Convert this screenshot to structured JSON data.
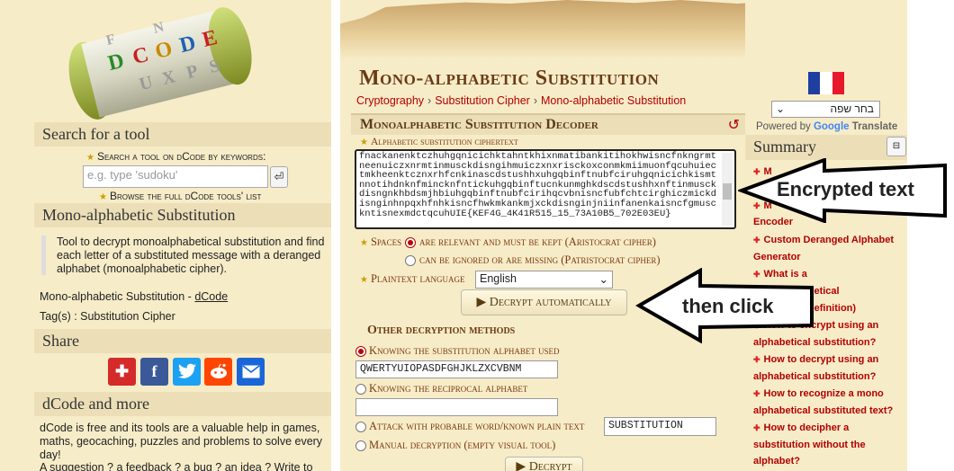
{
  "left": {
    "logo_text": "DCODE",
    "search_header": "Search for a tool",
    "search_label": "Search a tool on dCode by keywords:",
    "search_placeholder": "e.g. type 'sudoku'",
    "search_go_icon": "enter-icon",
    "browse_text": "Browse the full dCode tools' list",
    "tool_header": "Mono-alphabetic Substitution",
    "tool_desc": "Tool to decrypt monoalphabetical substitution and find each letter of a substituted message with a deranged alphabet (monoalphabetic cipher).",
    "credit_prefix": "Mono-alphabetic Substitution - ",
    "credit_link": "dCode",
    "tags": "Tag(s) : Substitution Cipher",
    "share_header": "Share",
    "share_buttons": [
      {
        "icon": "plus-icon",
        "color": "#d42a2a"
      },
      {
        "icon": "facebook-icon",
        "color": "#3b5998"
      },
      {
        "icon": "twitter-icon",
        "color": "#1da1f2"
      },
      {
        "icon": "reddit-icon",
        "color": "#ff4500"
      },
      {
        "icon": "email-icon",
        "color": "#1a66d8"
      }
    ],
    "more_header": "dCode and more",
    "more_text": "dCode is free and its tools are a valuable help in games, maths, geocaching, puzzles and problems to solve every day!",
    "more_text2": "A suggestion ? a feedback ? a bug ? an idea ? Write to"
  },
  "main": {
    "title": "Mono-alphabetic Substitution",
    "breadcrumb": [
      "Cryptography",
      "Substitution Cipher",
      "Mono-alphabetic Substitution"
    ],
    "decoder_title": "Monoalphabetic Substitution Decoder",
    "reset_icon": "reset-icon",
    "cipher_label": "Alphabetic substitution ciphertext",
    "ciphertext": "fnackanenktczhuhgqnicichktahntkhixnmatibankitihokhwisncfnkngrmtneenuiczxnrmtinmusckdisngihmuiczxnxrisckoxconmkmiimuonfqcuhuiectmkheenktcznxrhfcnkinascdstushhxuhgqbinftnubfciruhgqnicichkismtnnotihdnknfmincknfntickuhgqbinftucnkunmghkdscdstushhxnftinmusckdisngnkhbdsmjhbiuhgqbinftnubfcirihqcvbnisncfubfchtcirghiczmickdisnginhnpqxhfnhkisncfhwkmkankmjxckdisnginjniinfanenkaisncfgmusckntisnexmdctqcuhUIE{KEF4G_4K41R515_15_73A10B5_702E03EU}",
    "spaces_label": "Spaces",
    "spaces_opt1": "are relevant and must be kept (Aristocrat cipher)",
    "spaces_opt2": "can be ignored or are missing (Patristocrat cipher)",
    "lang_label": "Plaintext language",
    "lang_value": "English",
    "decrypt_auto": "Decrypt automatically",
    "other_title": "Other decryption methods",
    "method1": "Knowing the substitution alphabet used",
    "method1_value": "QWERTYUIOPASDFGHJKLZXCVBNM",
    "method2": "Knowing the reciprocal alphabet",
    "method2_value": "",
    "method3": "Attack with probable word/known plain text",
    "method3_value": "SUBSTITUTION",
    "method4": "Manual decryption (empty visual tool)",
    "decrypt": "Decrypt"
  },
  "right": {
    "lang_select": "בחר שפה",
    "powered_prefix": "Powered by ",
    "google": "Google",
    "translate": " Translate",
    "summary_header": "Summary",
    "summary_items": [
      "M",
      "M",
      "Encoder",
      "Custom Deranged Alphabet Generator",
      "What is a",
      "alphabetical",
      "(Definition)",
      "How to encrypt using an alphabetical substitution?",
      "How to decrypt using an alphabetical substitution?",
      "How to recognize a mono alphabetical substituted text?",
      "How to decipher a substitution without the alphabet?"
    ],
    "flag_colors": [
      "#1f3fa0",
      "#ffffff",
      "#e8182b"
    ]
  },
  "callouts": {
    "encrypted": "Encrypted text",
    "then_click": "then click"
  }
}
